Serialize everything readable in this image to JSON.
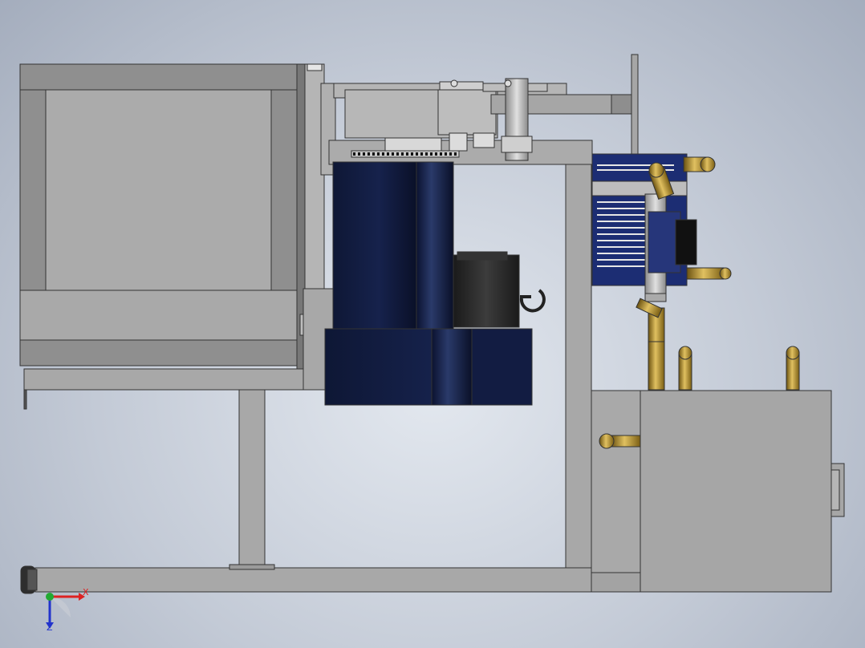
{
  "viewport": {
    "background": "#c3cad6"
  },
  "colors": {
    "frame": "#a6a6a6",
    "frame_dark": "#8c8c8c",
    "frame_stroke": "#3a3a3a",
    "motor_navy": "#101a3a",
    "motor_edge": "#0a0f22",
    "brass": "#b8952e",
    "brass_dark": "#6e5510",
    "pump_blue": "#1c2d73",
    "reducer_black": "#242424"
  },
  "components": [
    "feed-hopper",
    "drive-frame",
    "motor-upper",
    "motor-lower",
    "gear-reducer",
    "sprocket-chain",
    "crank-arm",
    "cooling-unit",
    "brass-fittings",
    "base-frame",
    "water-tank",
    "leveling-foot"
  ],
  "triad": {
    "x_label": "X",
    "z_label": "Z",
    "x_color": "#d22",
    "z_color": "#2233cc"
  }
}
